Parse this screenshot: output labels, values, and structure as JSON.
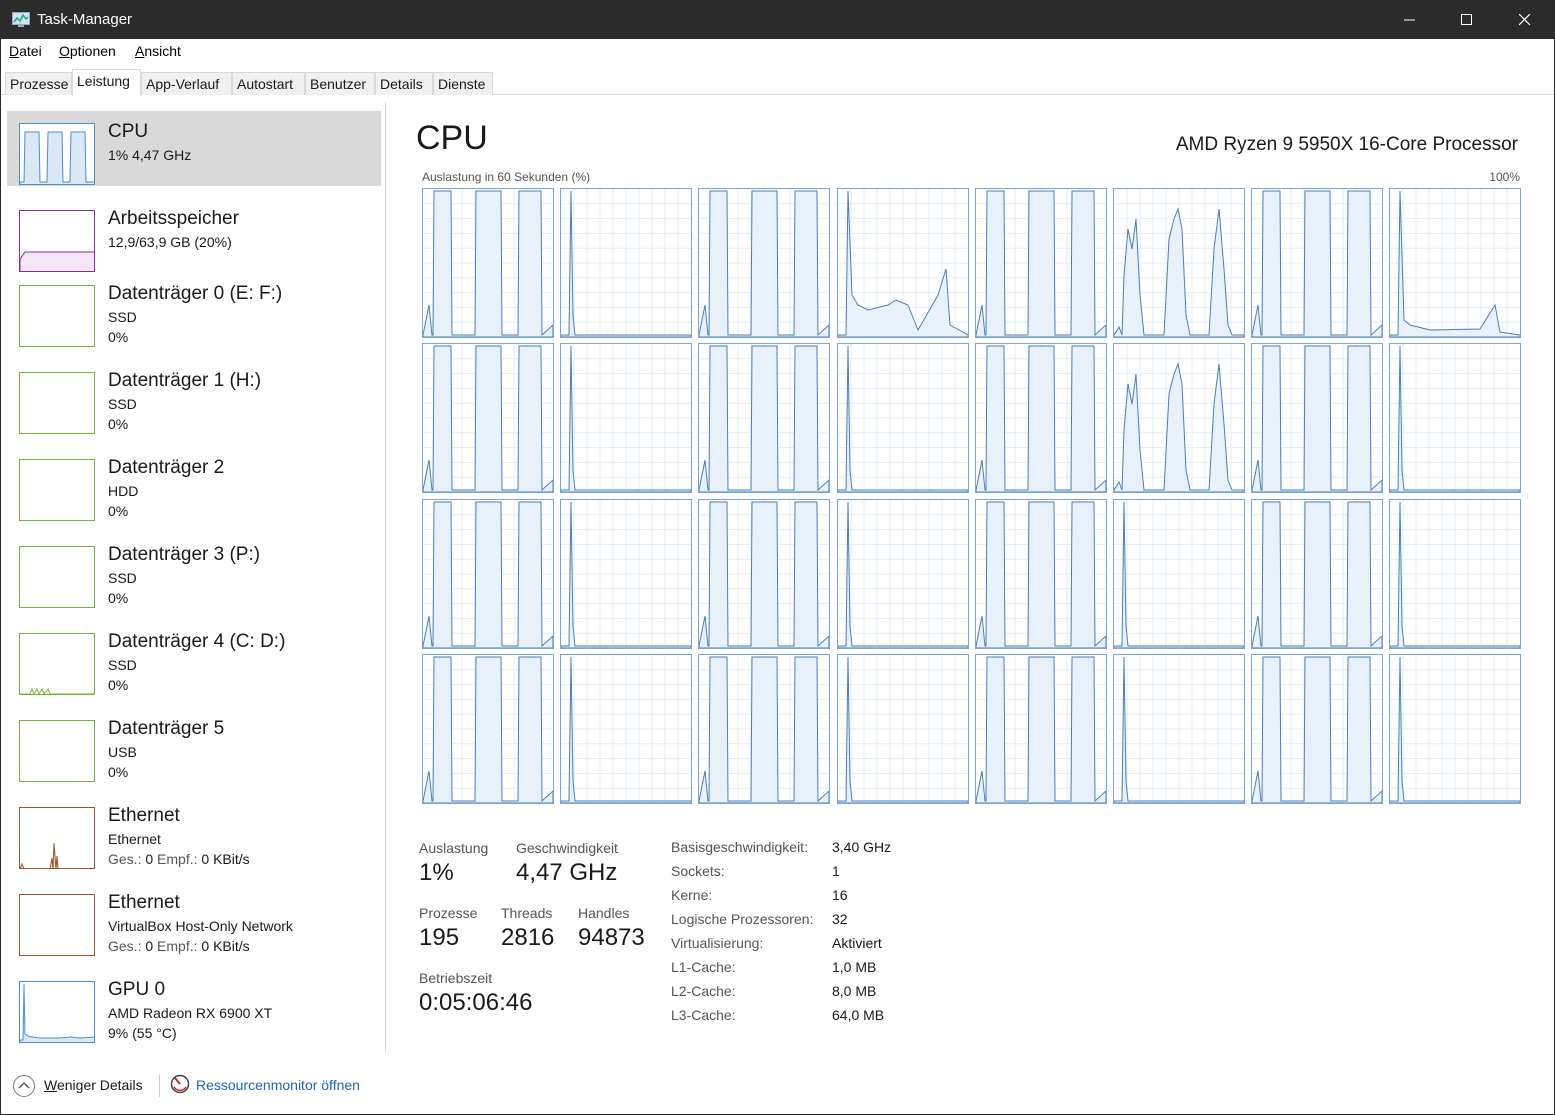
{
  "window": {
    "title": "Task-Manager"
  },
  "menu": [
    "Datei",
    "Optionen",
    "Ansicht"
  ],
  "tabs": [
    "Prozesse",
    "Leistung",
    "App-Verlauf",
    "Autostart",
    "Benutzer",
    "Details",
    "Dienste"
  ],
  "active_tab": "Leistung",
  "sidebar": {
    "items": [
      {
        "name": "CPU",
        "line2": "1%  4,47 GHz",
        "line3": "",
        "color": "#4a90c8",
        "selected": true
      },
      {
        "name": "Arbeitsspeicher",
        "line2": "12,9/63,9 GB (20%)",
        "line3": "",
        "color": "#8b2c9a"
      },
      {
        "name": "Datenträger 0 (E: F:)",
        "line2": "SSD",
        "line3": "0%",
        "color": "#7cb03a"
      },
      {
        "name": "Datenträger 1 (H:)",
        "line2": "SSD",
        "line3": "0%",
        "color": "#7cb03a"
      },
      {
        "name": "Datenträger 2",
        "line2": "HDD",
        "line3": "0%",
        "color": "#7cb03a"
      },
      {
        "name": "Datenträger 3 (P:)",
        "line2": "SSD",
        "line3": "0%",
        "color": "#7cb03a"
      },
      {
        "name": "Datenträger 4 (C: D:)",
        "line2": "SSD",
        "line3": "0%",
        "color": "#7cb03a"
      },
      {
        "name": "Datenträger 5",
        "line2": "USB",
        "line3": "0%",
        "color": "#7cb03a"
      },
      {
        "name": "Ethernet",
        "line2": "Ethernet",
        "line3_label1": "Ges.:",
        "line3_val1": "0",
        "line3_label2": "Empf.:",
        "line3_val2": "0 KBit/s",
        "color": "#a0522d"
      },
      {
        "name": "Ethernet",
        "line2": "VirtualBox Host-Only Network",
        "line3_label1": "Ges.:",
        "line3_val1": "0",
        "line3_label2": "Empf.:",
        "line3_val2": "0 KBit/s",
        "color": "#a0522d"
      },
      {
        "name": "GPU 0",
        "line2": "AMD Radeon RX 6900 XT",
        "line3": "9%  (55 °C)",
        "color": "#4a90c8"
      }
    ]
  },
  "main": {
    "title": "CPU",
    "model": "AMD Ryzen 9 5950X 16-Core Processor",
    "graph_label": "Auslastung in 60 Sekunden (%)",
    "graph_max": "100%",
    "accent": "#4a7fb5",
    "core_count": 32
  },
  "stats": {
    "auslastung_label": "Auslastung",
    "auslastung": "1%",
    "geschwindigkeit_label": "Geschwindigkeit",
    "geschwindigkeit": "4,47 GHz",
    "prozesse_label": "Prozesse",
    "prozesse": "195",
    "threads_label": "Threads",
    "threads": "2816",
    "handles_label": "Handles",
    "handles": "94873",
    "betriebszeit_label": "Betriebszeit",
    "betriebszeit": "0:05:06:46"
  },
  "info": [
    {
      "key": "Basisgeschwindigkeit:",
      "val": "3,40 GHz"
    },
    {
      "key": "Sockets:",
      "val": "1"
    },
    {
      "key": "Kerne:",
      "val": "16"
    },
    {
      "key": "Logische Prozessoren:",
      "val": "32"
    },
    {
      "key": "Virtualisierung:",
      "val": "Aktiviert"
    },
    {
      "key": "L1-Cache:",
      "val": "1,0 MB"
    },
    {
      "key": "L2-Cache:",
      "val": "8,0 MB"
    },
    {
      "key": "L3-Cache:",
      "val": "64,0 MB"
    }
  ],
  "footer": {
    "fewer_details": "Weniger Details",
    "resmon": "Ressourcenmonitor öffnen"
  }
}
